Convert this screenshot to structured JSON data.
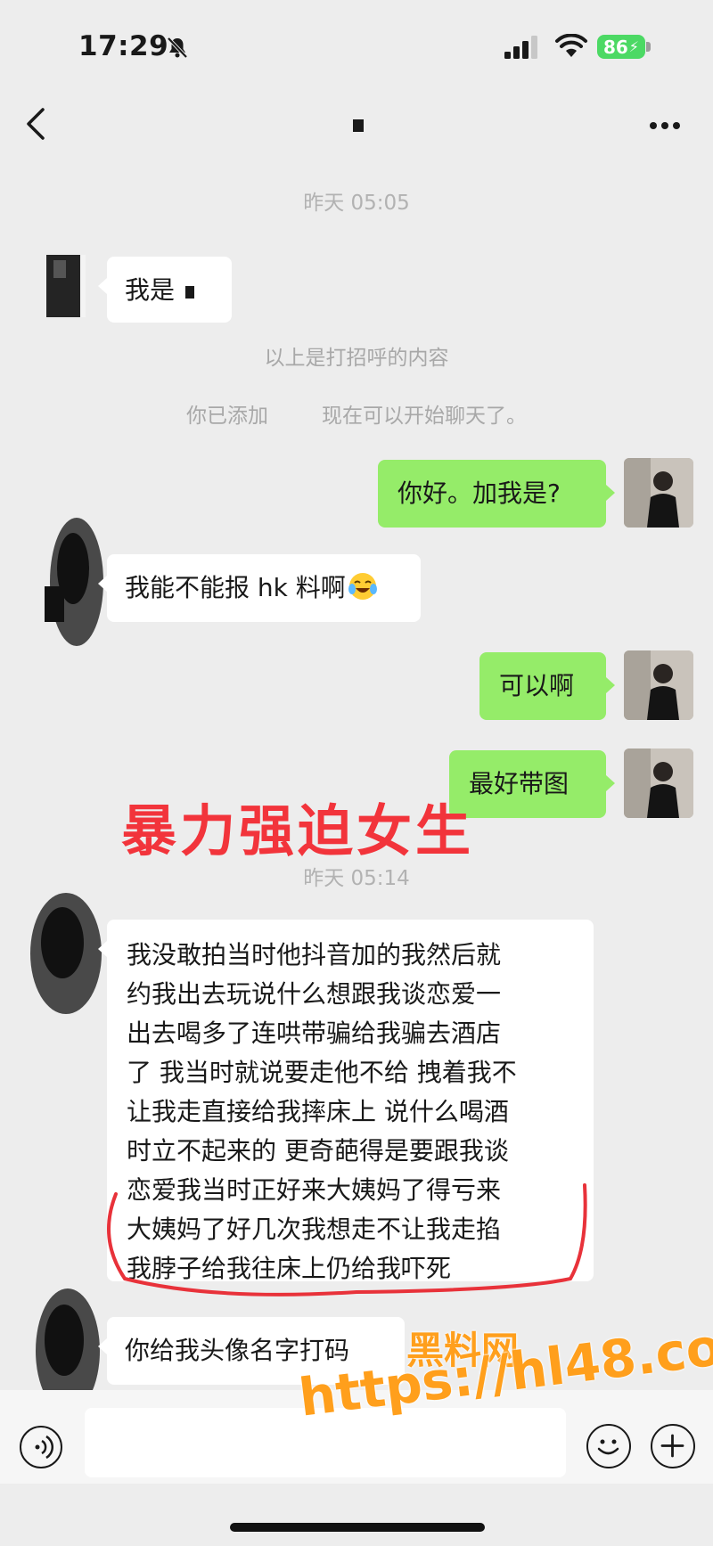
{
  "status_bar": {
    "time": "17:29",
    "battery": "86"
  },
  "chat": {
    "timestamp_1": "昨天 05:05",
    "greeting_msg_prefix": "我是",
    "system_1": "以上是打招呼的内容",
    "system_2a": "你已添加",
    "system_2b": "现在可以开始聊天了。",
    "msg_out_1": "你好。加我是?",
    "msg_in_2": "我能不能报 hk 料啊",
    "msg_out_2": "可以啊",
    "msg_out_3": "最好带图",
    "timestamp_2": "昨天 05:14",
    "long_msg_lines": [
      "我没敢拍当时他抖音加的我然后就",
      "约我出去玩说什么想跟我谈恋爱一",
      "出去喝多了连哄带骗给我骗去酒店",
      "了 我当时就说要走他不给 拽着我不",
      "让我走直接给我摔床上  说什么喝酒",
      "时立不起来的 更奇葩得是要跟我谈",
      "恋爱我当时正好来大姨妈了得亏来",
      "大姨妈了好几次我想走不让我走掐",
      "我脖子给我往床上仍给我吓死"
    ],
    "msg_in_last": "你给我头像名字打码"
  },
  "overlays": {
    "red_caption": "暴力强迫女生",
    "watermark_1": "黑料网",
    "watermark_2": "https://hl48.co"
  },
  "colors": {
    "bubble_out": "#95ec69",
    "bubble_in": "#ffffff",
    "background": "#ededed",
    "caption_red": "#f2343b",
    "watermark": "#ff9f1c"
  }
}
